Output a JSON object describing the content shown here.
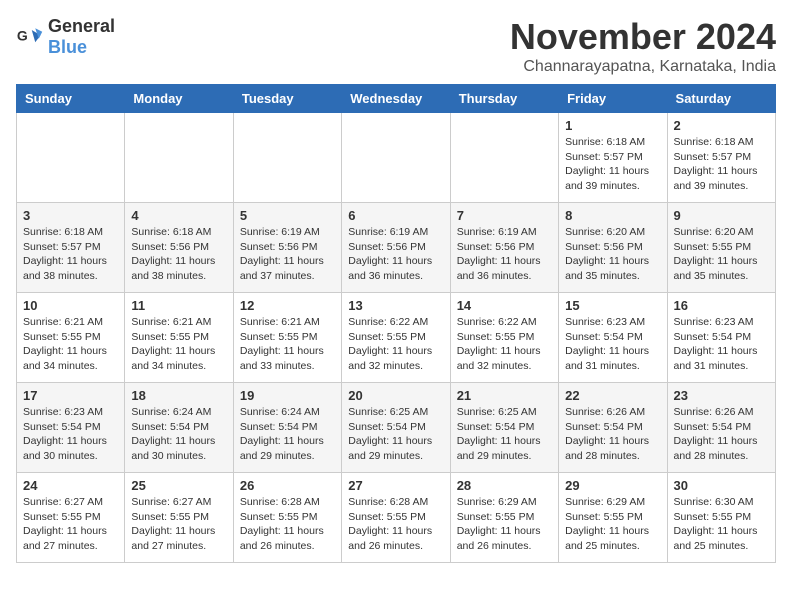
{
  "header": {
    "logo_general": "General",
    "logo_blue": "Blue",
    "month_title": "November 2024",
    "location": "Channarayapatna, Karnataka, India"
  },
  "weekdays": [
    "Sunday",
    "Monday",
    "Tuesday",
    "Wednesday",
    "Thursday",
    "Friday",
    "Saturday"
  ],
  "weeks": [
    [
      {
        "day": "",
        "info": ""
      },
      {
        "day": "",
        "info": ""
      },
      {
        "day": "",
        "info": ""
      },
      {
        "day": "",
        "info": ""
      },
      {
        "day": "",
        "info": ""
      },
      {
        "day": "1",
        "info": "Sunrise: 6:18 AM\nSunset: 5:57 PM\nDaylight: 11 hours and 39 minutes."
      },
      {
        "day": "2",
        "info": "Sunrise: 6:18 AM\nSunset: 5:57 PM\nDaylight: 11 hours and 39 minutes."
      }
    ],
    [
      {
        "day": "3",
        "info": "Sunrise: 6:18 AM\nSunset: 5:57 PM\nDaylight: 11 hours and 38 minutes."
      },
      {
        "day": "4",
        "info": "Sunrise: 6:18 AM\nSunset: 5:56 PM\nDaylight: 11 hours and 38 minutes."
      },
      {
        "day": "5",
        "info": "Sunrise: 6:19 AM\nSunset: 5:56 PM\nDaylight: 11 hours and 37 minutes."
      },
      {
        "day": "6",
        "info": "Sunrise: 6:19 AM\nSunset: 5:56 PM\nDaylight: 11 hours and 36 minutes."
      },
      {
        "day": "7",
        "info": "Sunrise: 6:19 AM\nSunset: 5:56 PM\nDaylight: 11 hours and 36 minutes."
      },
      {
        "day": "8",
        "info": "Sunrise: 6:20 AM\nSunset: 5:56 PM\nDaylight: 11 hours and 35 minutes."
      },
      {
        "day": "9",
        "info": "Sunrise: 6:20 AM\nSunset: 5:55 PM\nDaylight: 11 hours and 35 minutes."
      }
    ],
    [
      {
        "day": "10",
        "info": "Sunrise: 6:21 AM\nSunset: 5:55 PM\nDaylight: 11 hours and 34 minutes."
      },
      {
        "day": "11",
        "info": "Sunrise: 6:21 AM\nSunset: 5:55 PM\nDaylight: 11 hours and 34 minutes."
      },
      {
        "day": "12",
        "info": "Sunrise: 6:21 AM\nSunset: 5:55 PM\nDaylight: 11 hours and 33 minutes."
      },
      {
        "day": "13",
        "info": "Sunrise: 6:22 AM\nSunset: 5:55 PM\nDaylight: 11 hours and 32 minutes."
      },
      {
        "day": "14",
        "info": "Sunrise: 6:22 AM\nSunset: 5:55 PM\nDaylight: 11 hours and 32 minutes."
      },
      {
        "day": "15",
        "info": "Sunrise: 6:23 AM\nSunset: 5:54 PM\nDaylight: 11 hours and 31 minutes."
      },
      {
        "day": "16",
        "info": "Sunrise: 6:23 AM\nSunset: 5:54 PM\nDaylight: 11 hours and 31 minutes."
      }
    ],
    [
      {
        "day": "17",
        "info": "Sunrise: 6:23 AM\nSunset: 5:54 PM\nDaylight: 11 hours and 30 minutes."
      },
      {
        "day": "18",
        "info": "Sunrise: 6:24 AM\nSunset: 5:54 PM\nDaylight: 11 hours and 30 minutes."
      },
      {
        "day": "19",
        "info": "Sunrise: 6:24 AM\nSunset: 5:54 PM\nDaylight: 11 hours and 29 minutes."
      },
      {
        "day": "20",
        "info": "Sunrise: 6:25 AM\nSunset: 5:54 PM\nDaylight: 11 hours and 29 minutes."
      },
      {
        "day": "21",
        "info": "Sunrise: 6:25 AM\nSunset: 5:54 PM\nDaylight: 11 hours and 29 minutes."
      },
      {
        "day": "22",
        "info": "Sunrise: 6:26 AM\nSunset: 5:54 PM\nDaylight: 11 hours and 28 minutes."
      },
      {
        "day": "23",
        "info": "Sunrise: 6:26 AM\nSunset: 5:54 PM\nDaylight: 11 hours and 28 minutes."
      }
    ],
    [
      {
        "day": "24",
        "info": "Sunrise: 6:27 AM\nSunset: 5:55 PM\nDaylight: 11 hours and 27 minutes."
      },
      {
        "day": "25",
        "info": "Sunrise: 6:27 AM\nSunset: 5:55 PM\nDaylight: 11 hours and 27 minutes."
      },
      {
        "day": "26",
        "info": "Sunrise: 6:28 AM\nSunset: 5:55 PM\nDaylight: 11 hours and 26 minutes."
      },
      {
        "day": "27",
        "info": "Sunrise: 6:28 AM\nSunset: 5:55 PM\nDaylight: 11 hours and 26 minutes."
      },
      {
        "day": "28",
        "info": "Sunrise: 6:29 AM\nSunset: 5:55 PM\nDaylight: 11 hours and 26 minutes."
      },
      {
        "day": "29",
        "info": "Sunrise: 6:29 AM\nSunset: 5:55 PM\nDaylight: 11 hours and 25 minutes."
      },
      {
        "day": "30",
        "info": "Sunrise: 6:30 AM\nSunset: 5:55 PM\nDaylight: 11 hours and 25 minutes."
      }
    ]
  ]
}
